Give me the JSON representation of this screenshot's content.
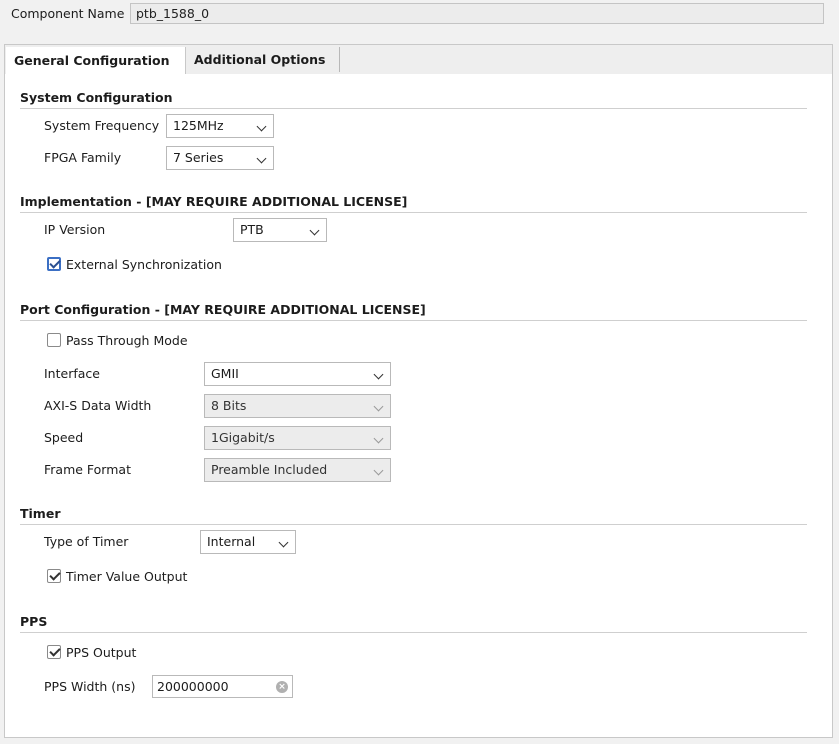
{
  "component": {
    "label": "Component Name",
    "value": "ptb_1588_0"
  },
  "tabs": [
    {
      "label": "General Configuration",
      "active": true
    },
    {
      "label": "Additional Options",
      "active": false
    }
  ],
  "system": {
    "heading": "System Configuration",
    "frequency_label": "System Frequency",
    "frequency_value": "125MHz",
    "family_label": "FPGA Family",
    "family_value": "7 Series"
  },
  "implementation": {
    "heading": "Implementation - [MAY REQUIRE ADDITIONAL LICENSE]",
    "ip_version_label": "IP Version",
    "ip_version_value": "PTB",
    "ext_sync_label": "External Synchronization",
    "ext_sync_checked": true
  },
  "port": {
    "heading": "Port Configuration - [MAY REQUIRE ADDITIONAL LICENSE]",
    "pass_through_label": "Pass Through Mode",
    "pass_through_checked": false,
    "interface_label": "Interface",
    "interface_value": "GMII",
    "axis_width_label": "AXI-S Data Width",
    "axis_width_value": "8 Bits",
    "speed_label": "Speed",
    "speed_value": "1Gigabit/s",
    "frame_format_label": "Frame Format",
    "frame_format_value": "Preamble Included"
  },
  "timer": {
    "heading": "Timer",
    "type_label": "Type of Timer",
    "type_value": "Internal",
    "value_output_label": "Timer Value Output",
    "value_output_checked": true
  },
  "pps": {
    "heading": "PPS",
    "output_label": "PPS Output",
    "output_checked": true,
    "width_label": "PPS Width (ns)",
    "width_value": "200000000"
  },
  "icons": {
    "dropdown": "chevron-down-icon",
    "clear": "clear-icon",
    "check": "checkmark-icon"
  },
  "colors": {
    "focus_border": "#3b6fc4",
    "panel_bg": "#ffffff",
    "window_bg": "#f1f1f1"
  }
}
